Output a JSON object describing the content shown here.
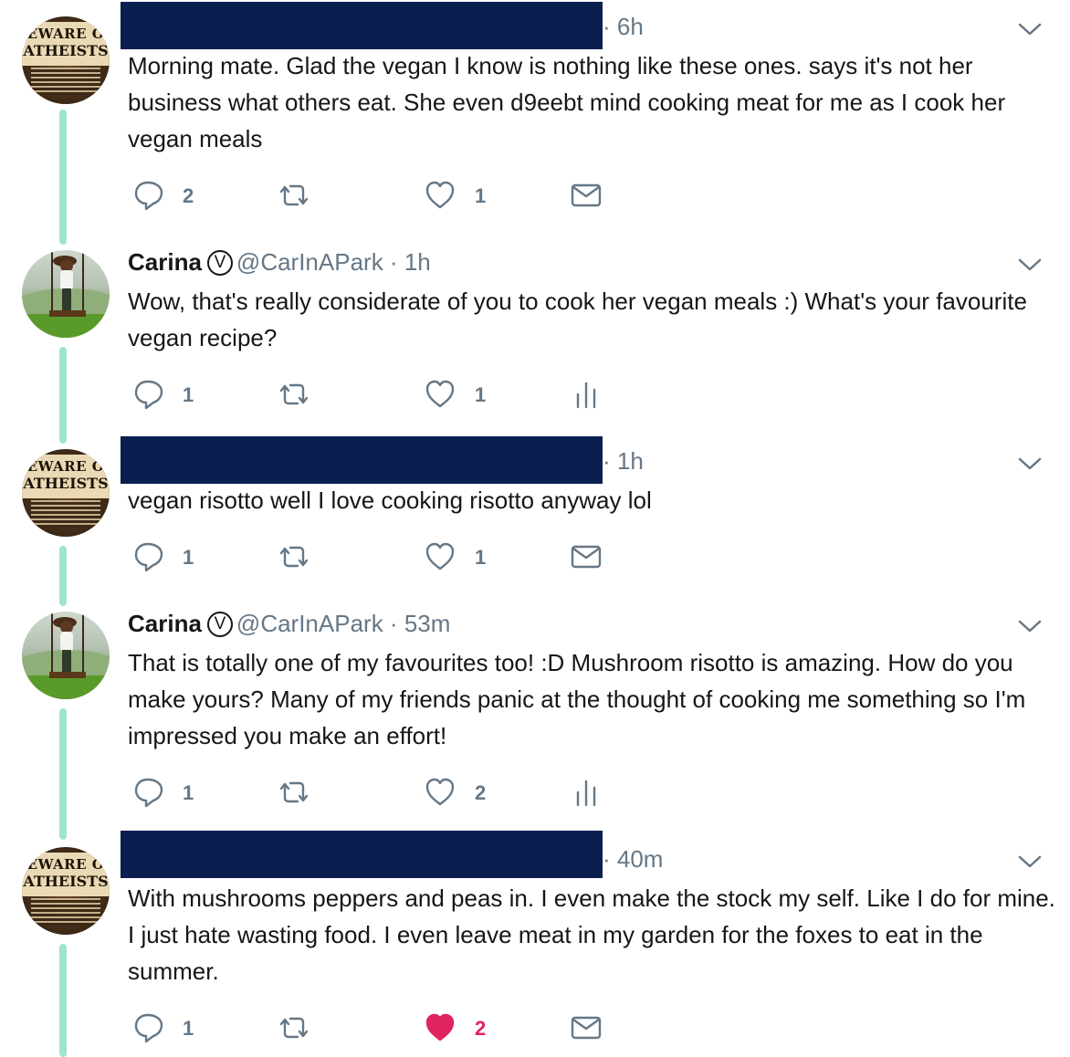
{
  "colors": {
    "thread": "#9ee6c9",
    "redaction": "#0a1f4f",
    "liked": "#e0245e",
    "muted": "#657786"
  },
  "tweets": [
    {
      "time": "6h",
      "text": "Morning mate. Glad the vegan I know is nothing like these ones. says it's not her business what others eat. She even d9eebt mind cooking meat for me as I cook her vegan meals",
      "reply_count": "2",
      "like_count": "1",
      "fourth_icon": "envelope-icon"
    },
    {
      "name": "Carina",
      "mark": "V",
      "handle": "@CarInAPark",
      "time": "1h",
      "text": "Wow, that's really considerate of you to cook her vegan meals :) What's your favourite vegan recipe?",
      "reply_count": "1",
      "like_count": "1",
      "fourth_icon": "analytics-icon"
    },
    {
      "time": "1h",
      "text": "vegan risotto well I love cooking risotto anyway lol",
      "reply_count": "1",
      "like_count": "1",
      "fourth_icon": "envelope-icon"
    },
    {
      "name": "Carina",
      "mark": "V",
      "handle": "@CarInAPark",
      "time": "53m",
      "text": "That is totally one of my favourites too! :D Mushroom risotto is amazing. How do you make yours? Many of my friends panic at the thought of cooking me something so I'm impressed you make an effort!",
      "reply_count": "1",
      "like_count": "2",
      "fourth_icon": "analytics-icon"
    },
    {
      "time": "40m",
      "text": "With mushrooms  peppers and peas in. I even make the stock my self. Like I do for mine. I just hate wasting food. I even leave meat in my garden for the foxes to eat in the summer.",
      "reply_count": "1",
      "like_count": "2",
      "liked": true,
      "fourth_icon": "envelope-icon"
    }
  ],
  "avatar_sign": {
    "line1": "EWARE O",
    "line2": "ATHEISTS"
  }
}
